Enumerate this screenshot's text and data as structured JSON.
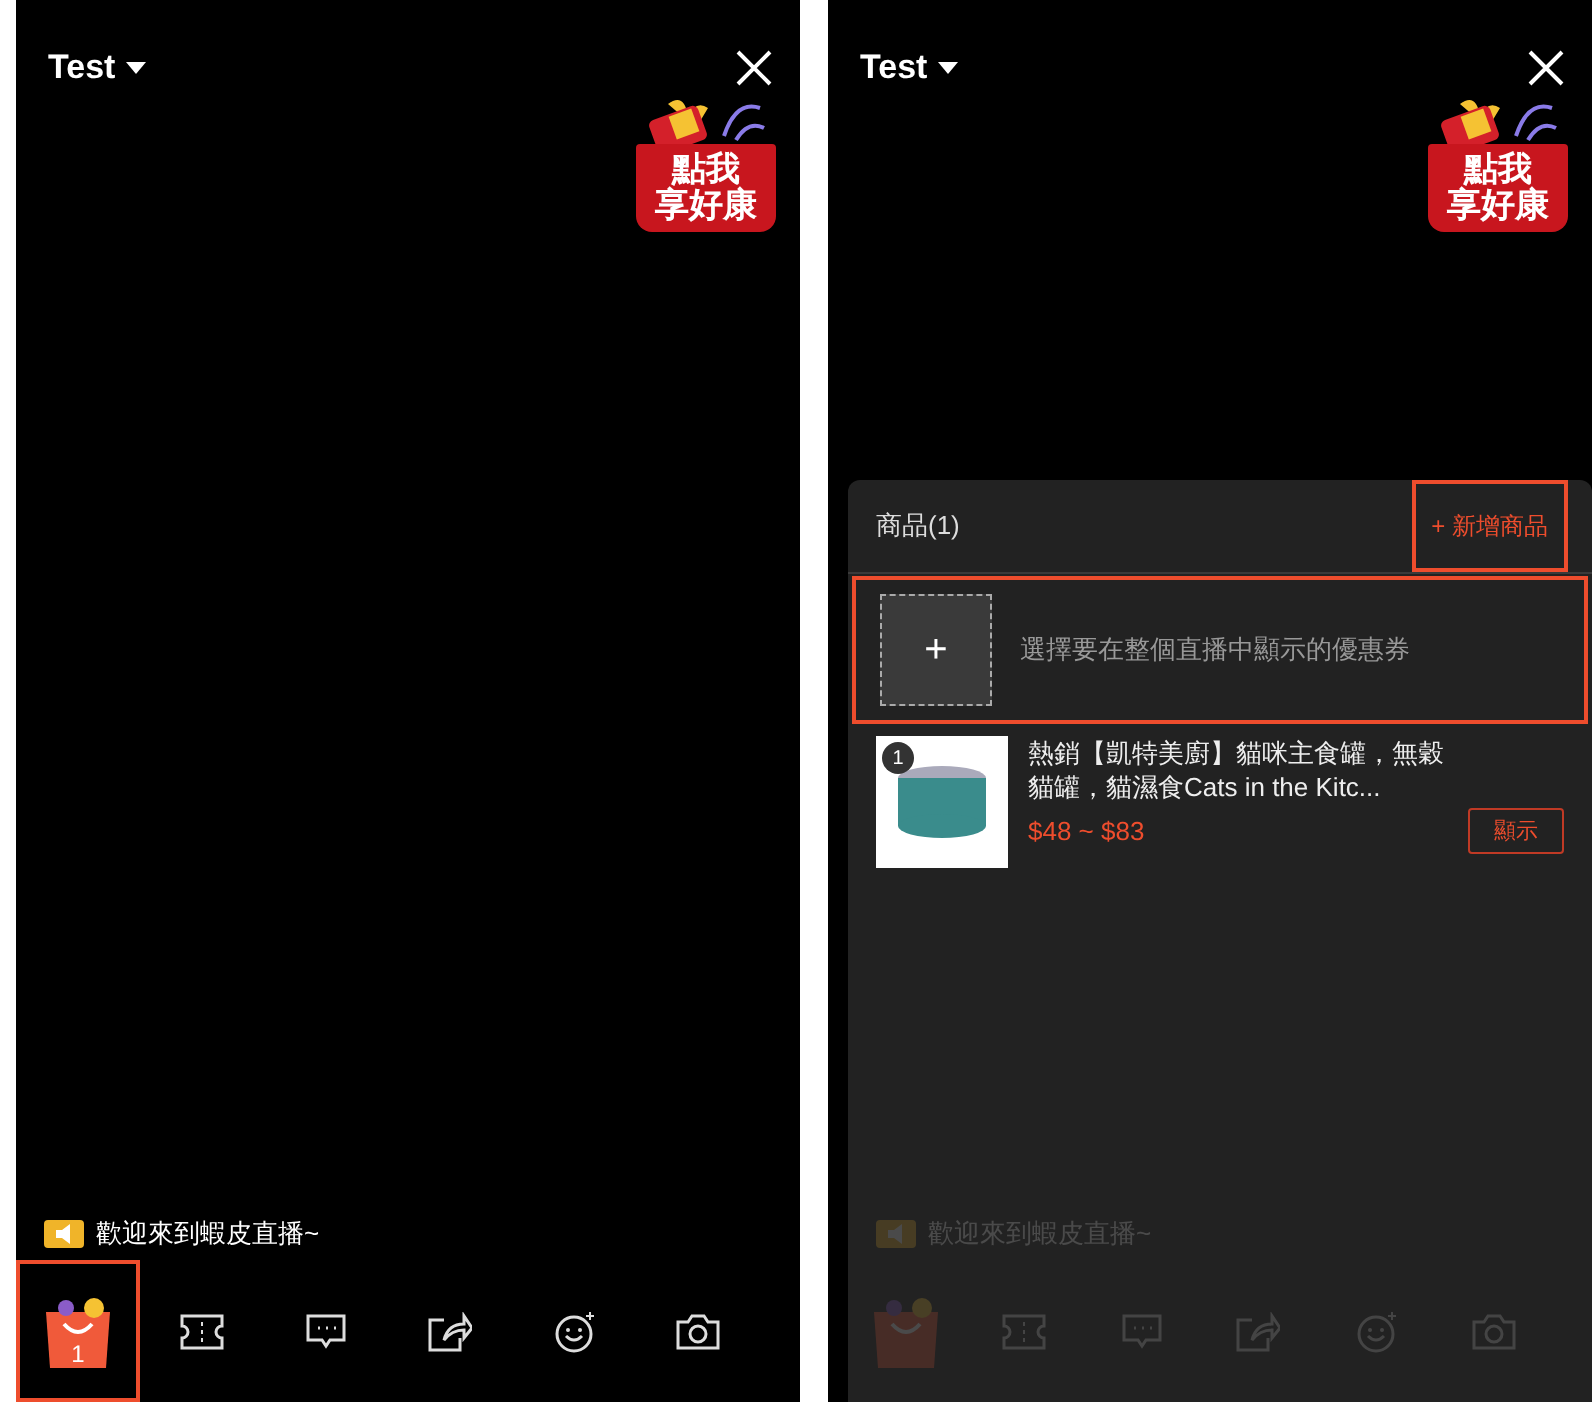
{
  "screens": [
    {
      "title": "Test",
      "promo_badge": {
        "lines": [
          "點我",
          "享好康"
        ]
      },
      "welcome": "歡迎來到蝦皮直播~",
      "dimmed": false,
      "toolbar": [
        {
          "kind": "shop",
          "count": "1",
          "highlighted": true
        },
        {
          "kind": "ticket",
          "highlighted": false
        },
        {
          "kind": "chat",
          "highlighted": false
        },
        {
          "kind": "share",
          "highlighted": false
        },
        {
          "kind": "emoji",
          "highlighted": false
        },
        {
          "kind": "camera",
          "highlighted": false
        }
      ]
    },
    {
      "title": "Test",
      "promo_badge": {
        "lines": [
          "點我",
          "享好康"
        ]
      },
      "welcome": "歡迎來到蝦皮直播~",
      "dimmed": true,
      "toolbar": [
        {
          "kind": "shop",
          "highlighted": false
        },
        {
          "kind": "ticket",
          "highlighted": false
        },
        {
          "kind": "chat",
          "highlighted": false
        },
        {
          "kind": "share",
          "highlighted": false
        },
        {
          "kind": "emoji",
          "highlighted": false
        },
        {
          "kind": "camera",
          "highlighted": false
        }
      ],
      "product_panel": {
        "title": "商品(1)",
        "add_button": {
          "label": "+ 新增商品",
          "highlighted": true
        },
        "coupon": {
          "label": "+",
          "hint": "選擇要在整個直播中顯示的優惠券",
          "highlighted": true
        },
        "products": [
          {
            "number": "1",
            "name": "熱銷【凱特美廚】貓咪主食罐，無穀貓罐，貓濕食Cats in the Kitc...",
            "price": "$48 ~ $83",
            "action": "顯示"
          }
        ]
      }
    }
  ]
}
